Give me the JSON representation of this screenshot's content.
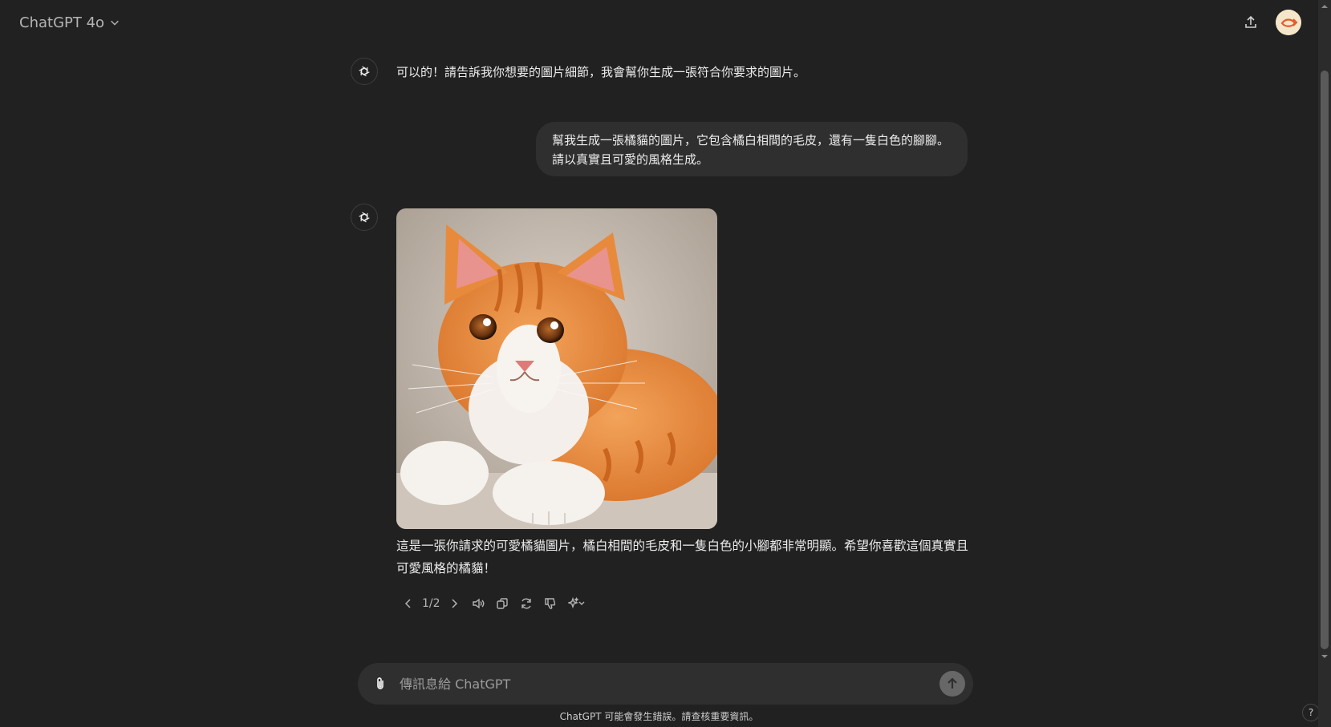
{
  "header": {
    "model_name": "ChatGPT 4o",
    "model_chevron_icon": "chevron-down-icon",
    "share_icon": "share-upload-icon",
    "avatar_icon": "user-avatar"
  },
  "conversation": {
    "assistant_message_1": "可以的！請告訴我你想要的圖片細節，我會幫你生成一張符合你要求的圖片。",
    "user_message": "幫我生成一張橘貓的圖片，它包含橘白相間的毛皮，還有一隻白色的腳腳。請以真實且可愛的風格生成。",
    "assistant_message_2": "這是一張你請求的可愛橘貓圖片，橘白相間的毛皮和一隻白色的小腳都非常明顯。希望你喜歡這個真實且可愛風格的橘貓！",
    "image_subject": "orange and white cat illustration"
  },
  "message_actions": {
    "pager": "1/2",
    "icons": [
      "chevron-left-icon",
      "chevron-right-icon",
      "read-aloud-icon",
      "copy-icon",
      "regenerate-icon",
      "thumbs-down-icon",
      "sparkle-model-icon"
    ]
  },
  "composer": {
    "placeholder": "傳訊息給 ChatGPT",
    "value": "",
    "attach_icon": "paperclip-icon",
    "send_icon": "arrow-up-icon"
  },
  "footer": {
    "disclaimer": "ChatGPT 可能會發生錯誤。請查核重要資訊。",
    "help_label": "?"
  },
  "colors": {
    "background": "#212121",
    "bubble": "#2f2f2f",
    "text": "#ececec",
    "muted": "#b4b4b4"
  }
}
